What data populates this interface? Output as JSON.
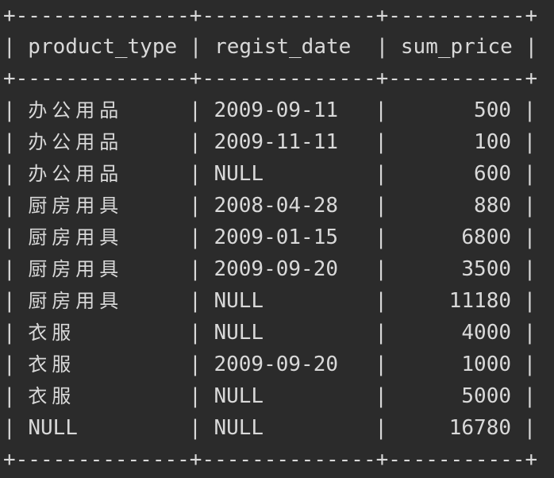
{
  "table": {
    "border_line": "+--------------+--------------+-----------+",
    "columns": [
      "product_type",
      "regist_date",
      "sum_price"
    ],
    "rows": [
      {
        "product_type": "办公用品",
        "regist_date": "2009-09-11",
        "sum_price": "500"
      },
      {
        "product_type": "办公用品",
        "regist_date": "2009-11-11",
        "sum_price": "100"
      },
      {
        "product_type": "办公用品",
        "regist_date": "NULL",
        "sum_price": "600"
      },
      {
        "product_type": "厨房用具",
        "regist_date": "2008-04-28",
        "sum_price": "880"
      },
      {
        "product_type": "厨房用具",
        "regist_date": "2009-01-15",
        "sum_price": "6800"
      },
      {
        "product_type": "厨房用具",
        "regist_date": "2009-09-20",
        "sum_price": "3500"
      },
      {
        "product_type": "厨房用具",
        "regist_date": "NULL",
        "sum_price": "11180"
      },
      {
        "product_type": "衣服",
        "regist_date": "NULL",
        "sum_price": "4000"
      },
      {
        "product_type": "衣服",
        "regist_date": "2009-09-20",
        "sum_price": "1000"
      },
      {
        "product_type": "衣服",
        "regist_date": "NULL",
        "sum_price": "5000"
      },
      {
        "product_type": "NULL",
        "regist_date": "NULL",
        "sum_price": "16780"
      }
    ]
  },
  "colors": {
    "background": "#2b2b2b",
    "text": "#d9d9d9"
  }
}
